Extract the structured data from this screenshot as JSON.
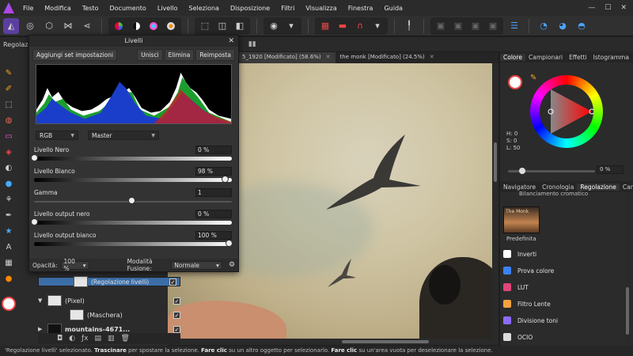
{
  "menu": [
    "File",
    "Modifica",
    "Testo",
    "Documento",
    "Livello",
    "Seleziona",
    "Disposizione",
    "Filtri",
    "Visualizza",
    "Finestra",
    "Guida"
  ],
  "window_controls": {
    "minimize": "—",
    "maximize": "☐",
    "close": "✕"
  },
  "context_label": "Regolazioni",
  "doc_tabs": [
    {
      "title": "5_1920 [Modificato] (58.6%)",
      "active": true
    },
    {
      "title": "the monk [Modificato] (24.5%)",
      "active": false
    }
  ],
  "levels": {
    "title": "Livelli",
    "buttons": {
      "add_preset": "Aggiungi set impostazioni",
      "merge": "Unisci",
      "delete": "Elimina",
      "reset": "Reimposta"
    },
    "channel_mode": "RGB",
    "channel": "Master",
    "params": [
      {
        "label": "Livello Nero",
        "value": "0 %",
        "pos": 0.0,
        "type": "dark"
      },
      {
        "label": "Livello Bianco",
        "value": "98 %",
        "pos": 0.98,
        "type": "dark"
      },
      {
        "label": "Gamma",
        "value": "1",
        "pos": 0.5,
        "type": "plain"
      },
      {
        "label": "Livello output nero",
        "value": "0 %",
        "pos": 0.0,
        "type": "dark"
      },
      {
        "label": "Livello output bianco",
        "value": "100 %",
        "pos": 1.0,
        "type": "dark"
      }
    ],
    "opacity_label": "Opacità:",
    "opacity_value": "100 %",
    "blend_label": "Modalità Fusione:",
    "blend_value": "Normale"
  },
  "layers": [
    {
      "name": "(Regolazione livelli)",
      "selected": true,
      "indent": 2,
      "thumb": "light",
      "arrow": ""
    },
    {
      "name": "(Pixel)",
      "selected": false,
      "indent": 0,
      "thumb": "light",
      "arrow": "▼"
    },
    {
      "name": "(Maschera)",
      "selected": false,
      "indent": 2,
      "thumb": "light",
      "arrow": ""
    },
    {
      "name": "mountains-4671...",
      "selected": false,
      "indent": 0,
      "thumb": "dark",
      "arrow": "▶"
    }
  ],
  "right_tabs": [
    "Colore",
    "Campionari",
    "Effetti",
    "Istogramma"
  ],
  "color": {
    "h": "H: 0",
    "s": "S: 0",
    "l": "L: 50",
    "opacity": "0 %"
  },
  "adj_tabs": [
    "Navigatore",
    "Cronologia",
    "Regolazione",
    "Canali"
  ],
  "adj_header": "Bilanciamento cromatico",
  "preset": {
    "thumb_text": "The Monk",
    "label": "Predefinita"
  },
  "adjustments": [
    {
      "label": "Inverti",
      "color": "#ffffff"
    },
    {
      "label": "Prova colore",
      "color": "#3b82f6"
    },
    {
      "label": "LUT",
      "color": "#e0457b"
    },
    {
      "label": "Filtro Lente",
      "color": "#f4a340"
    },
    {
      "label": "Divisione toni",
      "color": "#8a6cff"
    },
    {
      "label": "OCIO",
      "color": "#dddddd"
    }
  ],
  "status": {
    "s1": "'Regolazione livelli' selezionato. ",
    "b1": "Trascinare",
    "s2": " per spostare la selezione. ",
    "b2": "Fare clic",
    "s3": " su un altro oggetto per selezionarlo. ",
    "b3": "Fare clic",
    "s4": " su un'area vuota per deselezionare la selezione."
  }
}
